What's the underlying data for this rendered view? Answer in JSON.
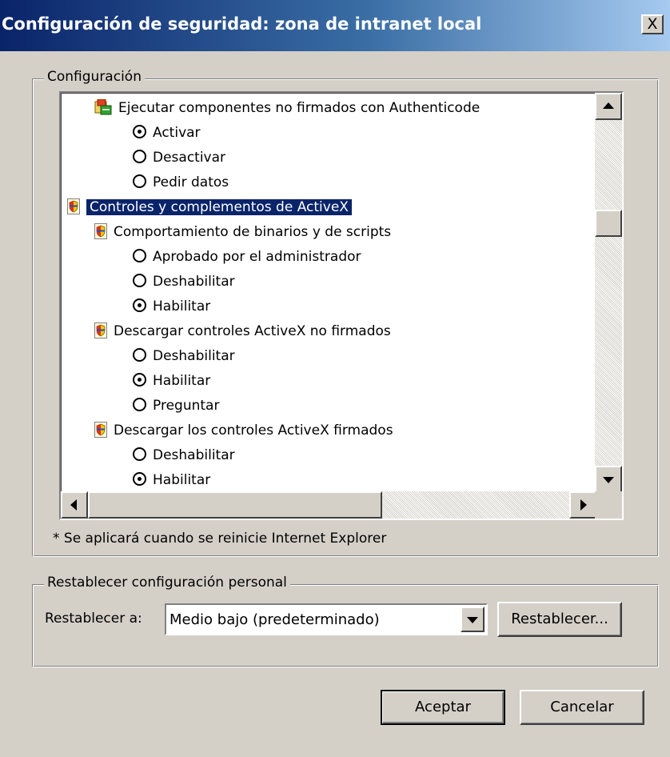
{
  "window": {
    "title": "Configuración de seguridad: zona de intranet local",
    "close_label": "X"
  },
  "settings_group": {
    "legend": "Configuración",
    "note": "* Se aplicará cuando se reinicie Internet Explorer"
  },
  "tree": {
    "items": [
      {
        "kind": "setting",
        "icon": "authenticode-icon",
        "label": "Ejecutar componentes no firmados con Authenticode"
      },
      {
        "kind": "option",
        "label": "Activar",
        "checked": true
      },
      {
        "kind": "option",
        "label": "Desactivar",
        "checked": false
      },
      {
        "kind": "option",
        "label": "Pedir datos",
        "checked": false
      },
      {
        "kind": "category",
        "icon": "security-shield-icon",
        "label": "Controles y complementos de ActiveX",
        "selected": true
      },
      {
        "kind": "setting",
        "icon": "security-shield-icon",
        "label": "Comportamiento de binarios y de scripts"
      },
      {
        "kind": "option",
        "label": "Aprobado por el administrador",
        "checked": false
      },
      {
        "kind": "option",
        "label": "Deshabilitar",
        "checked": false
      },
      {
        "kind": "option",
        "label": "Habilitar",
        "checked": true
      },
      {
        "kind": "setting",
        "icon": "security-shield-icon",
        "label": "Descargar controles ActiveX no firmados"
      },
      {
        "kind": "option",
        "label": "Deshabilitar",
        "checked": false
      },
      {
        "kind": "option",
        "label": "Habilitar",
        "checked": true
      },
      {
        "kind": "option",
        "label": "Preguntar",
        "checked": false
      },
      {
        "kind": "setting",
        "icon": "security-shield-icon",
        "label": "Descargar los controles ActiveX firmados"
      },
      {
        "kind": "option",
        "label": "Deshabilitar",
        "checked": false
      },
      {
        "kind": "option",
        "label": "Habilitar",
        "checked": true
      }
    ]
  },
  "reset_group": {
    "legend": "Restablecer configuración personal",
    "reset_to_label": "Restablecer a:",
    "reset_level_value": "Medio bajo (predeterminado)",
    "reset_button_label": "Restablecer..."
  },
  "footer": {
    "ok_label": "Aceptar",
    "cancel_label": "Cancelar"
  }
}
